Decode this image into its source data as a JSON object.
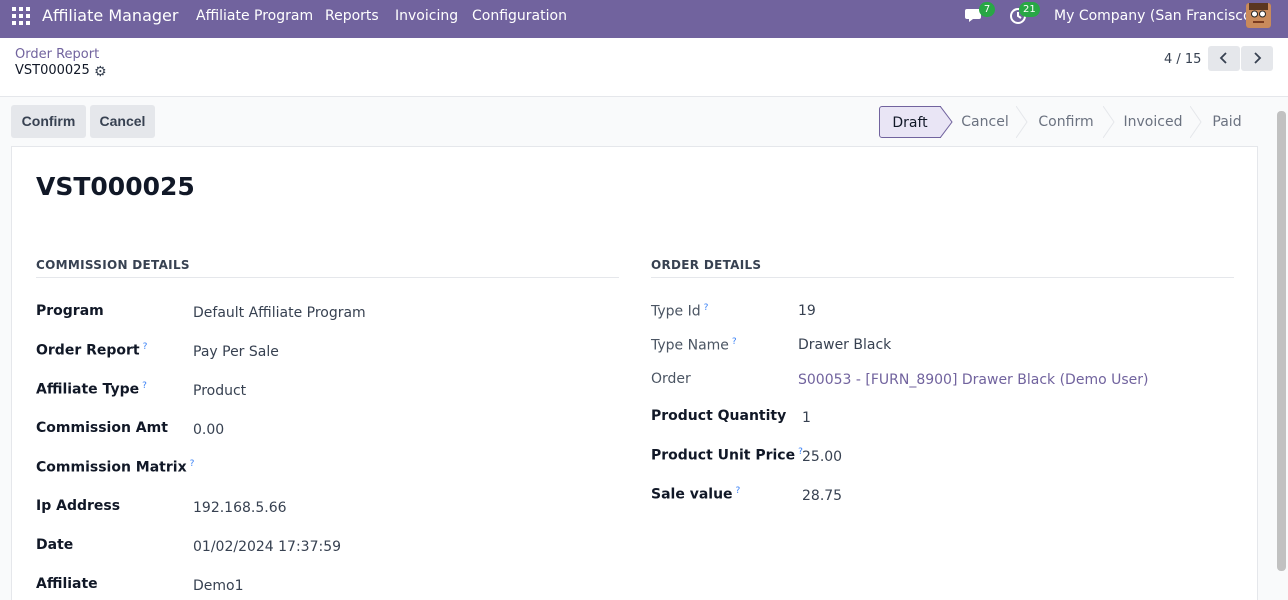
{
  "navbar": {
    "brand": "Affiliate Manager",
    "menus": [
      "Affiliate Program",
      "Reports",
      "Invoicing",
      "Configuration"
    ],
    "messages_badge": "7",
    "activities_badge": "21",
    "company": "My Company (San Francisco)"
  },
  "breadcrumb": {
    "parent": "Order Report",
    "current": "VST000025"
  },
  "pager": {
    "value": "4 / 15"
  },
  "actions": {
    "confirm_label": "Confirm",
    "cancel_label": "Cancel"
  },
  "statusbar": {
    "stages": [
      "Draft",
      "Cancel",
      "Confirm",
      "Invoiced",
      "Paid"
    ],
    "active": "Draft"
  },
  "record": {
    "title": "VST000025",
    "commission_section": "COMMISSION DETAILS",
    "order_section": "ORDER DETAILS",
    "commission_fields": [
      {
        "label": "Program",
        "help": "",
        "value": "Default Affiliate Program"
      },
      {
        "label": "Order Report",
        "help": "?",
        "value": "Pay Per Sale"
      },
      {
        "label": "Affiliate Type",
        "help": "?",
        "value": "Product"
      },
      {
        "label": "Commission Amt",
        "help": "",
        "value": "0.00"
      },
      {
        "label": "Commission Matrix",
        "help": "?",
        "value": ""
      },
      {
        "label": "Ip Address",
        "help": "",
        "value": "192.168.5.66"
      },
      {
        "label": "Date",
        "help": "",
        "value": "01/02/2024 17:37:59"
      },
      {
        "label": "Affiliate",
        "help": "",
        "value": "Demo1"
      }
    ],
    "order_fields": [
      {
        "label": "Type Id",
        "help": "?",
        "value": "19"
      },
      {
        "label": "Type Name",
        "help": "?",
        "value": "Drawer Black"
      },
      {
        "label": "Order",
        "help": "",
        "value": "S00053 - [FURN_8900] Drawer Black (Demo User)"
      },
      {
        "label": "Product Quantity",
        "help": "",
        "value": "1"
      },
      {
        "label": "Product Unit Price",
        "help": "?",
        "value": "25.00"
      },
      {
        "label": "Sale value",
        "help": "?",
        "value": "28.75"
      }
    ]
  },
  "colors": {
    "brand": "#71639e",
    "badge": "#28a745",
    "help": "#3b82f6"
  }
}
